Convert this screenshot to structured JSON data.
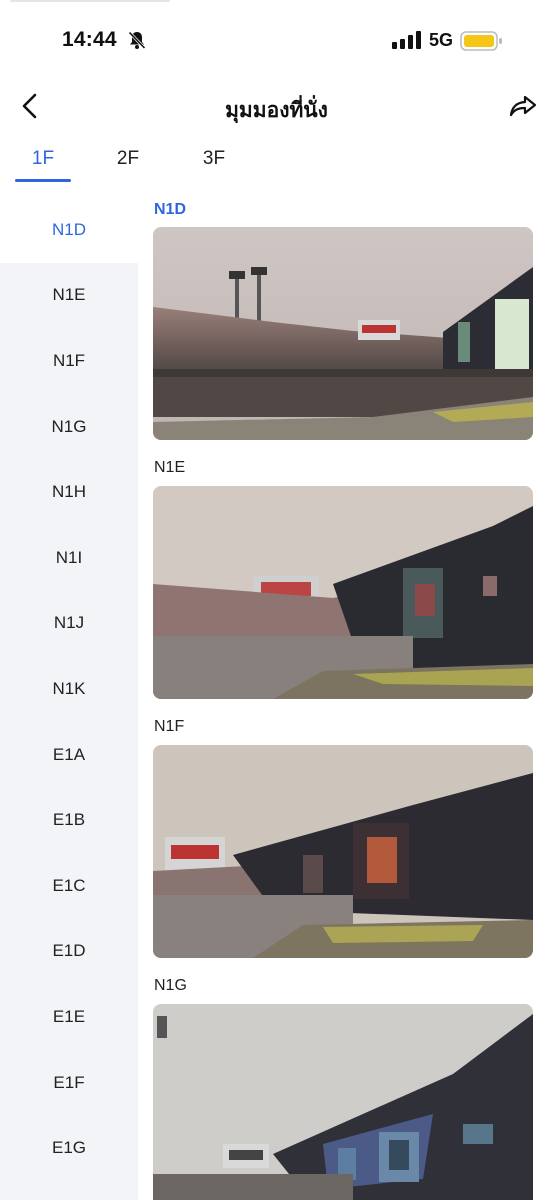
{
  "status_bar": {
    "time": "14:44",
    "network": "5G"
  },
  "nav": {
    "title": "มุมมองที่นั่ง"
  },
  "floor_tabs": [
    "1F",
    "2F",
    "3F"
  ],
  "active_floor": "1F",
  "sidebar": {
    "items": [
      "N1D",
      "N1E",
      "N1F",
      "N1G",
      "N1H",
      "N1I",
      "N1J",
      "N1K",
      "E1A",
      "E1B",
      "E1C",
      "E1D",
      "E1E",
      "E1F",
      "E1G"
    ],
    "active": "N1D"
  },
  "sections": [
    {
      "label": "N1D",
      "photo": "stadium-view-photo"
    },
    {
      "label": "N1E",
      "photo": "stadium-view-photo"
    },
    {
      "label": "N1F",
      "photo": "stadium-view-photo"
    },
    {
      "label": "N1G",
      "photo": "stadium-view-photo"
    }
  ],
  "colors": {
    "accent": "#2f66e0",
    "sidebar_bg": "#f3f4f8",
    "battery": "#f5c518"
  }
}
